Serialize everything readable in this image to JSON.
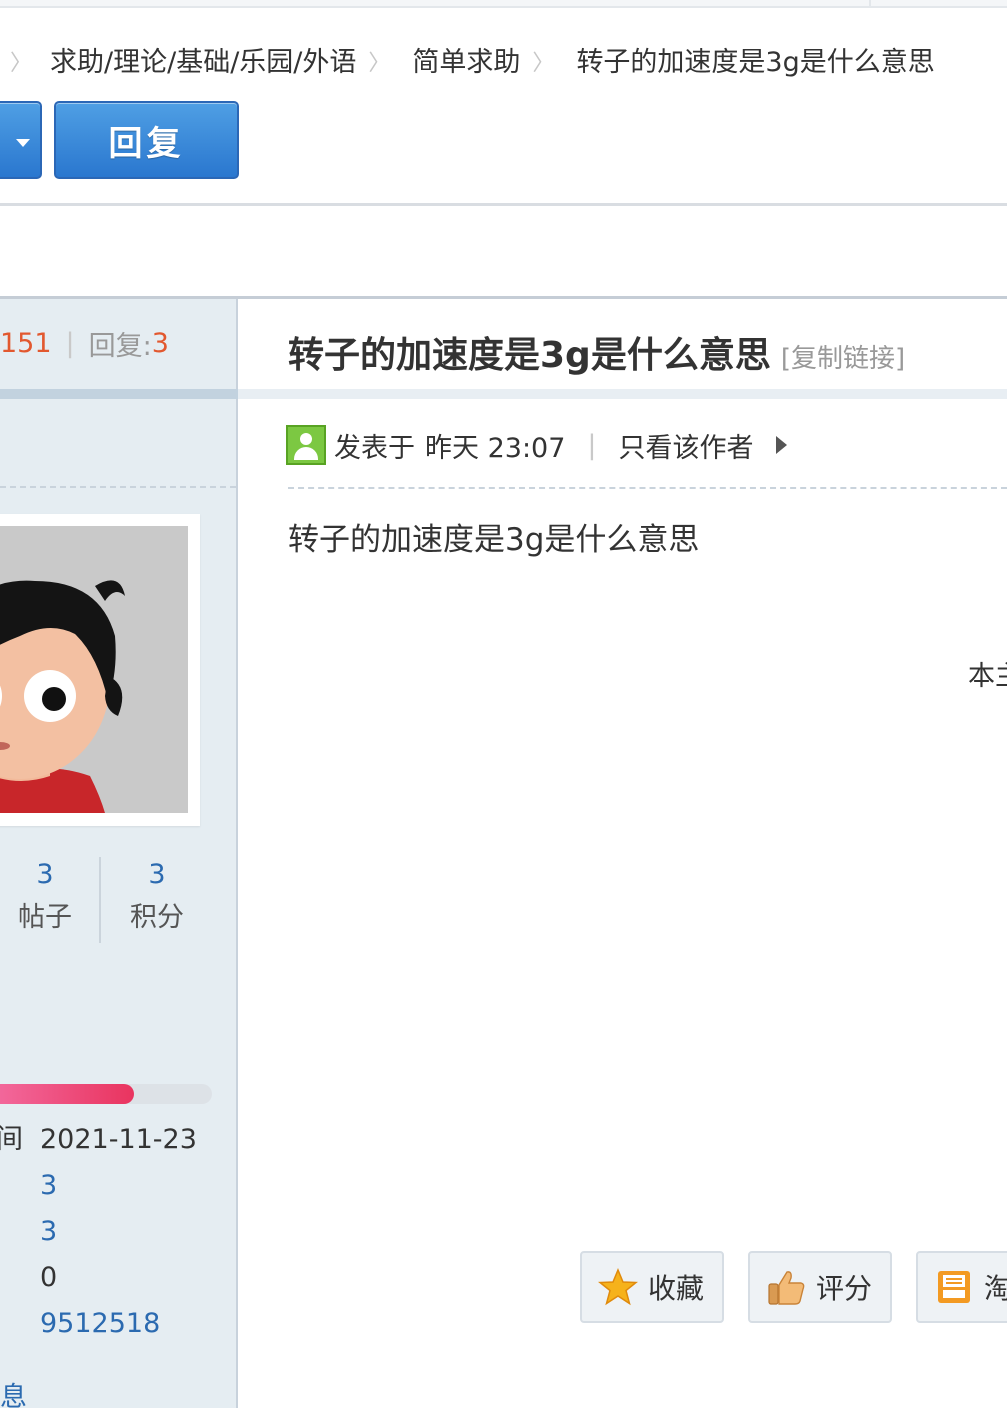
{
  "breadcrumb": {
    "items": [
      "求助/理论/基础/乐园/外语",
      "简单求助",
      "转子的加速度是3g是什么意思"
    ]
  },
  "toolbar": {
    "reply_label": "回复"
  },
  "thread_stats": {
    "views_value": "151",
    "replies_label": "回复:",
    "replies_value": "3"
  },
  "post": {
    "title": "转子的加速度是3g是什么意思",
    "copy_link": "[复制链接]",
    "posted_prefix": "发表于",
    "posted_time": "昨天 23:07",
    "only_author": "只看该作者",
    "body": "转子的加速度是3g是什么意思",
    "edge_note": "本主"
  },
  "author": {
    "posts_value": "3",
    "posts_label": "帖子",
    "points_value": "3",
    "points_label": "积分",
    "progress_fraction": 0.65,
    "info_key_fragment": "间",
    "register_date": "2021-11-23",
    "line2": "3",
    "line3": "3",
    "line4": "0",
    "line5": "9512518",
    "more_fragment": "息"
  },
  "actions": {
    "favorite": "收藏",
    "rate": "评分",
    "tao": "淘"
  },
  "colors": {
    "accent_blue": "#2a77cf",
    "link_blue": "#2b6ab0",
    "stat_orange": "#e2582f",
    "progress_pink": "#e9345f"
  }
}
